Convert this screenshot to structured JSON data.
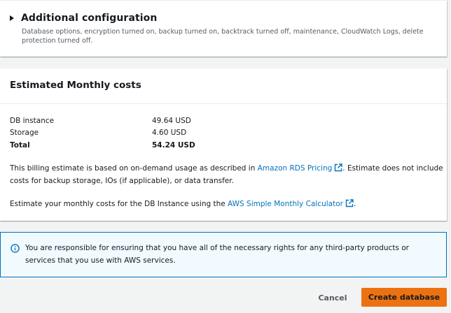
{
  "additional_configuration": {
    "title": "Additional configuration",
    "description": "Database options, encryption turned on, backup turned on, backtrack turned off, maintenance, CloudWatch Logs, delete protection turned off."
  },
  "estimated_costs": {
    "title": "Estimated Monthly costs",
    "rows": [
      {
        "label": "DB instance",
        "value": "49.64 USD"
      },
      {
        "label": "Storage",
        "value": "4.60 USD"
      },
      {
        "label": "Total",
        "value": "54.24 USD"
      }
    ],
    "billing_prefix": "This billing estimate is based on on-demand usage as described in ",
    "billing_link": "Amazon RDS Pricing",
    "billing_suffix": ". Estimate does not include costs for backup storage, IOs (if applicable), or data transfer.",
    "estimate_prefix": "Estimate your monthly costs for the DB Instance using the ",
    "estimate_link": "AWS Simple Monthly Calculator",
    "estimate_suffix": "."
  },
  "info_alert": {
    "text": "You are responsible for ensuring that you have all of the necessary rights for any third-party products or services that you use with AWS services."
  },
  "actions": {
    "cancel_label": "Cancel",
    "create_label": "Create database"
  },
  "icons": {
    "expand": "caret-right-icon",
    "external_link": "external-link-icon",
    "info": "info-icon"
  },
  "colors": {
    "link": "#0073bb",
    "primary_button": "#ec7211",
    "info_background": "#f1faff",
    "info_border": "#0073bb"
  }
}
